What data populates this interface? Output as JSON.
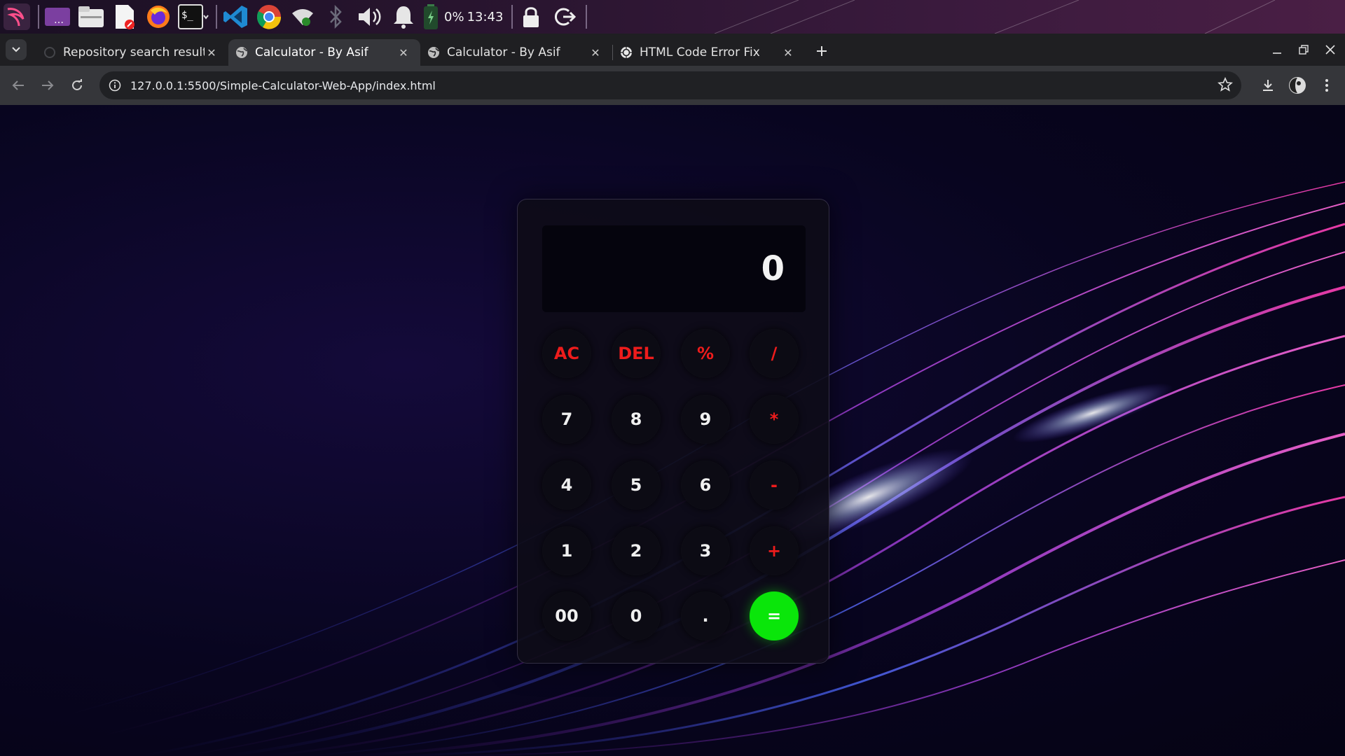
{
  "taskbar": {
    "battery_text": "0%",
    "clock": "13:43"
  },
  "browser": {
    "tabs": [
      {
        "title": "Repository search results",
        "active": false
      },
      {
        "title": "Calculator - By Asif",
        "active": true
      },
      {
        "title": "Calculator - By Asif",
        "active": false
      },
      {
        "title": "HTML Code Error Fix",
        "active": false
      }
    ],
    "url": "127.0.0.1:5500/Simple-Calculator-Web-App/index.html"
  },
  "calculator": {
    "display": "0",
    "keys": {
      "ac": "AC",
      "del": "DEL",
      "percent": "%",
      "divide": "/",
      "seven": "7",
      "eight": "8",
      "nine": "9",
      "multiply": "*",
      "four": "4",
      "five": "5",
      "six": "6",
      "subtract": "-",
      "one": "1",
      "two": "2",
      "three": "3",
      "add": "+",
      "double_zero": "00",
      "zero": "0",
      "decimal": ".",
      "equals": "="
    }
  },
  "colors": {
    "operator_red": "#ee1c1c",
    "equals_green": "#0ae60a",
    "calc_body": "#0e0c18"
  }
}
